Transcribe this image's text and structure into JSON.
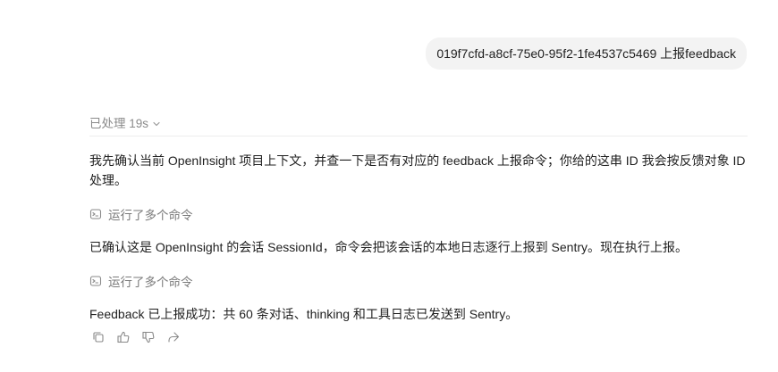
{
  "user_message": "019f7cfd-a8cf-75e0-95f2-1fe4537c5469  上报feedback",
  "processed": {
    "label": "已处理 19s"
  },
  "assistant": {
    "paragraph_1": "我先确认当前 OpenInsight 项目上下文，并查一下是否有对应的 feedback 上报命令；你给的这串 ID 我会按反馈对象 ID 处理。",
    "command_1": "运行了多个命令",
    "paragraph_2": "已确认这是 OpenInsight 的会话 SessionId，命令会把该会话的本地日志逐行上报到 Sentry。现在执行上报。",
    "command_2": "运行了多个命令",
    "paragraph_3": "Feedback 已上报成功：共 60 条对话、thinking 和工具日志已发送到 Sentry。"
  },
  "actions": {
    "icons": [
      "copy-icon",
      "thumbs-up-icon",
      "thumbs-down-icon",
      "share-icon"
    ]
  }
}
